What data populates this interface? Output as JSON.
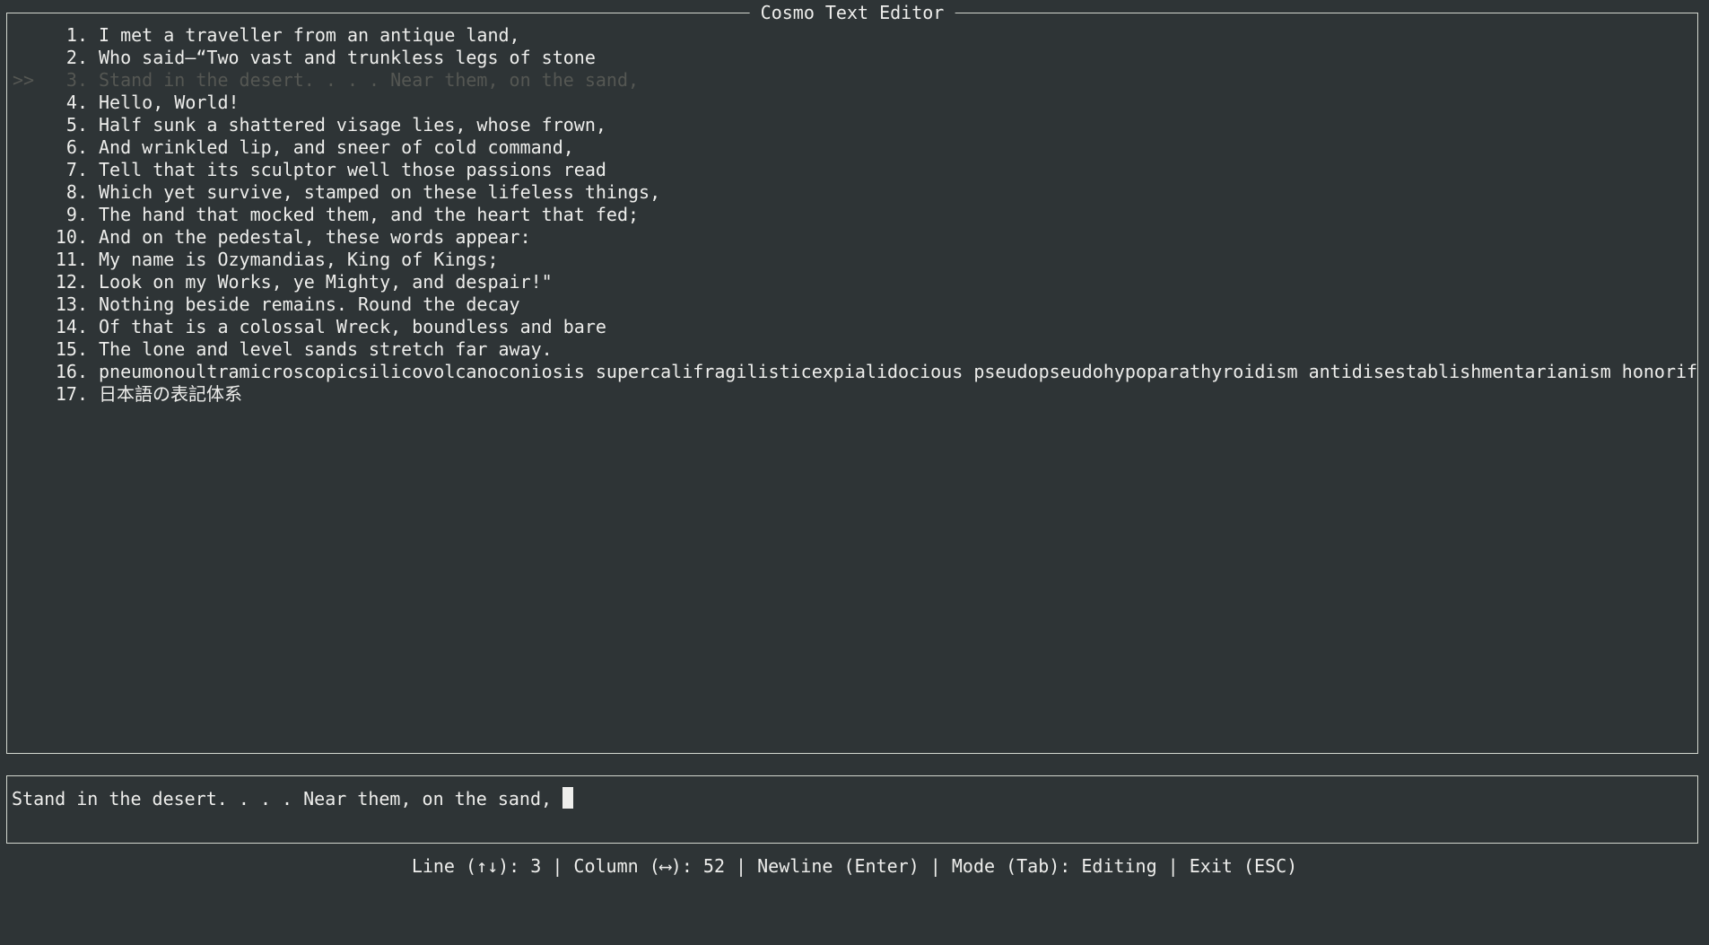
{
  "window": {
    "title": "Cosmo Text Editor"
  },
  "editor": {
    "current_marker": ">>",
    "current_line": 3,
    "lines": [
      {
        "num": "1.",
        "text": "I met a traveller from an antique land,"
      },
      {
        "num": "2.",
        "text": "Who said—“Two vast and trunkless legs of stone"
      },
      {
        "num": "3.",
        "text": "Stand in the desert. . . . Near them, on the sand,"
      },
      {
        "num": "4.",
        "text": "Hello, World!"
      },
      {
        "num": "5.",
        "text": "Half sunk a shattered visage lies, whose frown,"
      },
      {
        "num": "6.",
        "text": "And wrinkled lip, and sneer of cold command,"
      },
      {
        "num": "7.",
        "text": "Tell that its sculptor well those passions read"
      },
      {
        "num": "8.",
        "text": "Which yet survive, stamped on these lifeless things,"
      },
      {
        "num": "9.",
        "text": "The hand that mocked them, and the heart that fed;"
      },
      {
        "num": "10.",
        "text": "And on the pedestal, these words appear:"
      },
      {
        "num": "11.",
        "text": "My name is Ozymandias, King of Kings;"
      },
      {
        "num": "12.",
        "text": "Look on my Works, ye Mighty, and despair!\""
      },
      {
        "num": "13.",
        "text": "Nothing beside remains. Round the decay"
      },
      {
        "num": "14.",
        "text": "Of that is a colossal Wreck, boundless and bare"
      },
      {
        "num": "15.",
        "text": "The lone and level sands stretch far away."
      },
      {
        "num": "16.",
        "text": "pneumonoultramicroscopicsilicovolcanoconiosis supercalifragilisticexpialidocious pseudopseudohypoparathyroidism antidisestablishmentarianism honorif"
      },
      {
        "num": "17.",
        "text": "日本語の表記体系"
      }
    ]
  },
  "input": {
    "value": "Stand in the desert. . . . Near them, on the sand, "
  },
  "status_bar": {
    "text": "Line (↑↓): 3 | Column (⟷): 52 | Newline (Enter) | Mode (Tab): Editing | Exit (ESC)"
  },
  "colors": {
    "background": "#2e3436",
    "foreground": "#eeeeec",
    "dimmed": "#555753",
    "border": "#d3d7cf"
  }
}
